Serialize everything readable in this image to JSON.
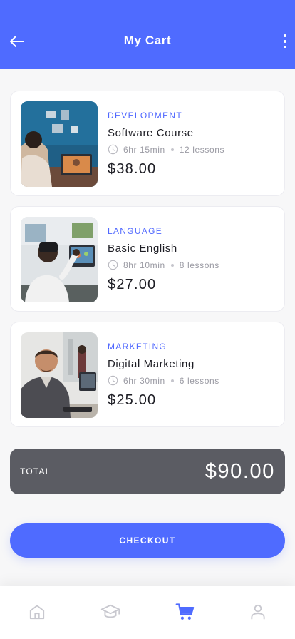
{
  "header": {
    "title": "My Cart",
    "back_icon": "arrow-left-icon",
    "menu_icon": "more-vertical-icon",
    "background_color": "#4f6bff"
  },
  "cart": {
    "items": [
      {
        "category": "DEVELOPMENT",
        "title": "Software Course",
        "duration": "6hr 15min",
        "lessons": "12 lessons",
        "price": "$38.00",
        "image": "woman-on-video-call-photo"
      },
      {
        "category": "LANGUAGE",
        "title": "Basic English",
        "duration": "8hr 10min",
        "lessons": "8 lessons",
        "price": "$27.00",
        "image": "man-with-vr-headset-photo"
      },
      {
        "category": "MARKETING",
        "title": "Digital Marketing",
        "duration": "6hr 30min",
        "lessons": "6 lessons",
        "price": "$25.00",
        "image": "man-at-office-desk-photo"
      }
    ]
  },
  "summary": {
    "total_label": "TOTAL",
    "total_amount": "$90.00"
  },
  "checkout": {
    "label": "CHECKOUT"
  },
  "bottom_nav": {
    "items": [
      {
        "icon": "home-icon",
        "active": false
      },
      {
        "icon": "graduation-cap-icon",
        "active": false
      },
      {
        "icon": "cart-icon",
        "active": true
      },
      {
        "icon": "user-icon",
        "active": false
      }
    ],
    "active_color": "#4f6bff",
    "inactive_color": "#c8c8cf"
  },
  "colors": {
    "accent": "#4f6bff",
    "category_text": "#5068ff",
    "total_bar": "#5b5c63"
  }
}
